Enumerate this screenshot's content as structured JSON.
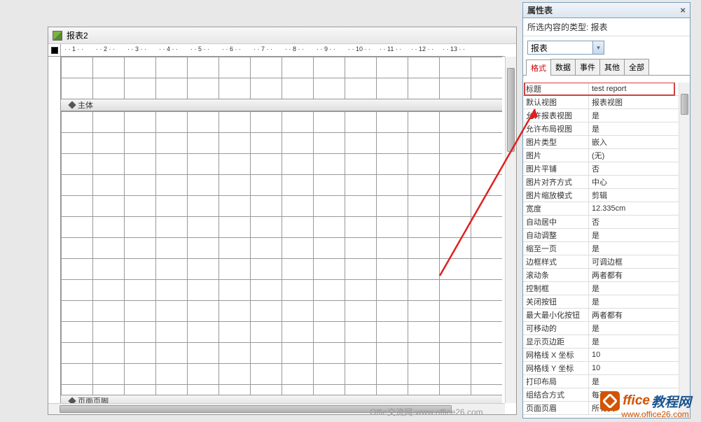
{
  "designWindow": {
    "title": "报表2",
    "section_body": "主体",
    "section_footer": "页面页脚",
    "ruler_ticks": [
      "1",
      "2",
      "3",
      "4",
      "5",
      "6",
      "7",
      "8",
      "9",
      "10",
      "11",
      "12",
      "13"
    ]
  },
  "propertySheet": {
    "title": "属性表",
    "subtitle": "所选内容的类型: 报表",
    "dropdown_value": "报表",
    "tabs": [
      "格式",
      "数据",
      "事件",
      "其他",
      "全部"
    ],
    "activeTab": 0,
    "rows": [
      {
        "label": "标题",
        "value": "test report",
        "highlight": true
      },
      {
        "label": "默认视图",
        "value": "报表视图"
      },
      {
        "label": "允许报表视图",
        "value": "是"
      },
      {
        "label": "允许布局视图",
        "value": "是"
      },
      {
        "label": "图片类型",
        "value": "嵌入"
      },
      {
        "label": "图片",
        "value": "(无)"
      },
      {
        "label": "图片平铺",
        "value": "否"
      },
      {
        "label": "图片对齐方式",
        "value": "中心"
      },
      {
        "label": "图片缩放模式",
        "value": "剪辑"
      },
      {
        "label": "宽度",
        "value": "12.335cm"
      },
      {
        "label": "自动居中",
        "value": "否"
      },
      {
        "label": "自动调整",
        "value": "是"
      },
      {
        "label": "缩至一页",
        "value": "是"
      },
      {
        "label": "边框样式",
        "value": "可调边框"
      },
      {
        "label": "滚动条",
        "value": "两者都有"
      },
      {
        "label": "控制框",
        "value": "是"
      },
      {
        "label": "关闭按钮",
        "value": "是"
      },
      {
        "label": "最大最小化按钮",
        "value": "两者都有"
      },
      {
        "label": "可移动的",
        "value": "是"
      },
      {
        "label": "显示页边距",
        "value": "是"
      },
      {
        "label": "网格线 X 坐标",
        "value": "10"
      },
      {
        "label": "网格线 Y 坐标",
        "value": "10"
      },
      {
        "label": "打印布局",
        "value": "是"
      },
      {
        "label": "组结合方式",
        "value": "每列"
      },
      {
        "label": "页面页眉",
        "value": "所有页"
      }
    ]
  },
  "watermarks": {
    "w1": "Offie交流网-www.office26.com",
    "logo_text1": "ffice",
    "logo_text2": "教程网",
    "logo_url": "www.office26.com"
  }
}
